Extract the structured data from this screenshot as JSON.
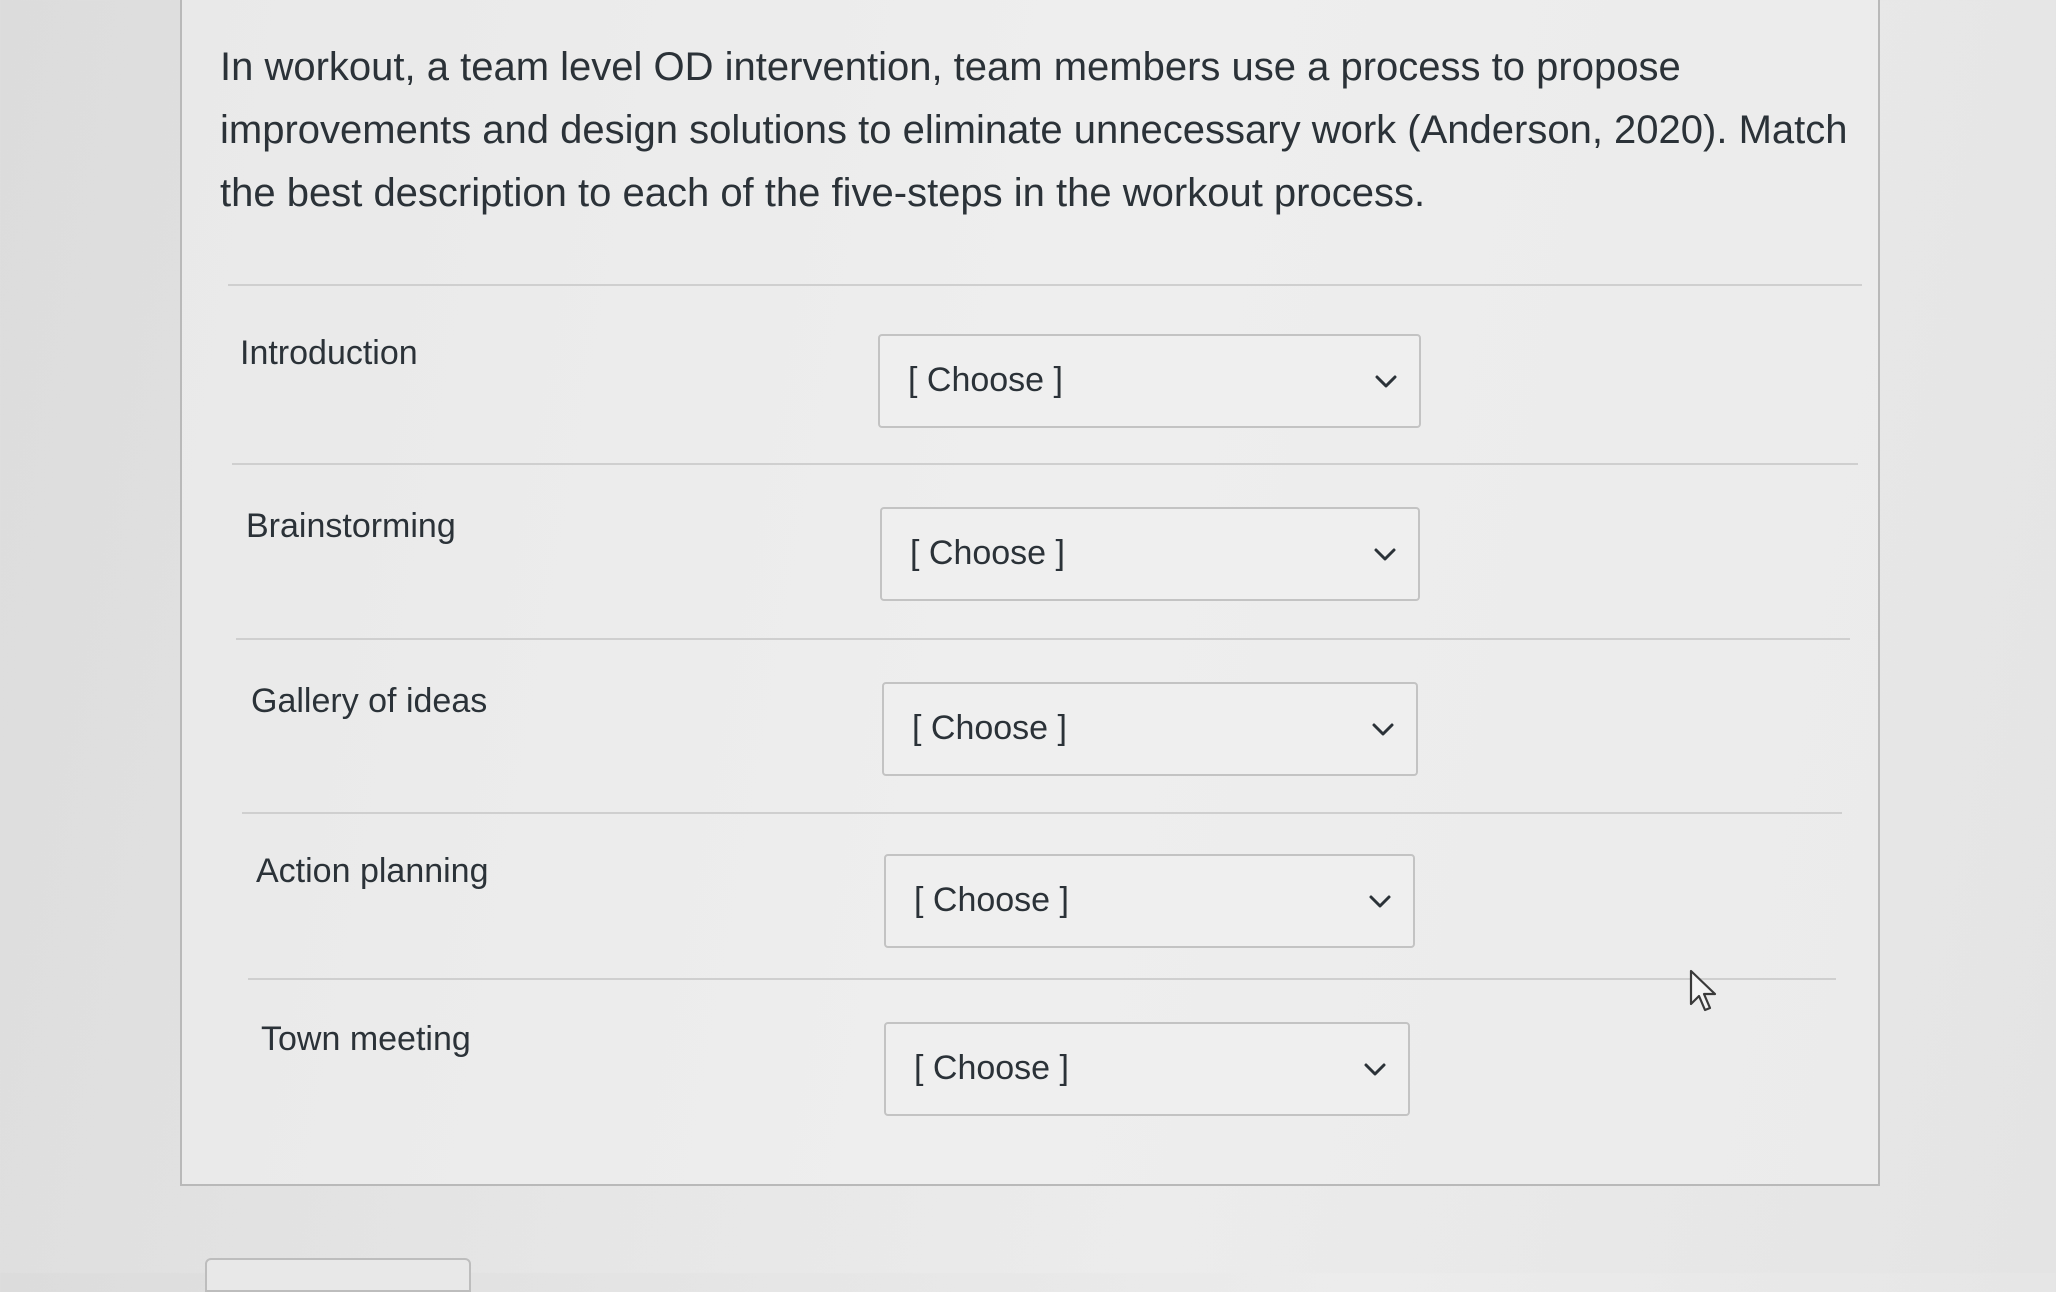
{
  "question": {
    "text": "In workout, a team level OD intervention, team members use a process to propose improvements and design solutions to eliminate unnecessary work (Anderson, 2020).  Match the best description to each of the five-steps in the workout process."
  },
  "rows": [
    {
      "label": "Introduction",
      "select_value": "[ Choose ]"
    },
    {
      "label": "Brainstorming",
      "select_value": "[ Choose ]"
    },
    {
      "label": "Gallery of ideas",
      "select_value": "[ Choose ]"
    },
    {
      "label": "Action planning",
      "select_value": "[ Choose ]"
    },
    {
      "label": "Town meeting",
      "select_value": "[ Choose ]"
    }
  ],
  "icons": {
    "dropdown": "chevron-down-icon",
    "cursor": "mouse-pointer-icon"
  },
  "colors": {
    "text": "#2b3238",
    "border": "#c3c3c3",
    "panel": "#eeeeee"
  }
}
